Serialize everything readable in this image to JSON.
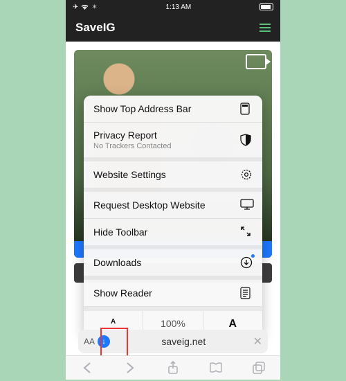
{
  "statusbar": {
    "time": "1:13 AM"
  },
  "app": {
    "title": "SaveIG"
  },
  "sheet": {
    "show_top": "Show Top Address Bar",
    "privacy": "Privacy Report",
    "privacy_sub": "No Trackers Contacted",
    "website_settings": "Website Settings",
    "request_desktop": "Request Desktop Website",
    "hide_toolbar": "Hide Toolbar",
    "downloads": "Downloads",
    "show_reader": "Show Reader"
  },
  "zoom": {
    "pct": "100%"
  },
  "address": {
    "aa": "AA",
    "url": "saveig.net"
  }
}
